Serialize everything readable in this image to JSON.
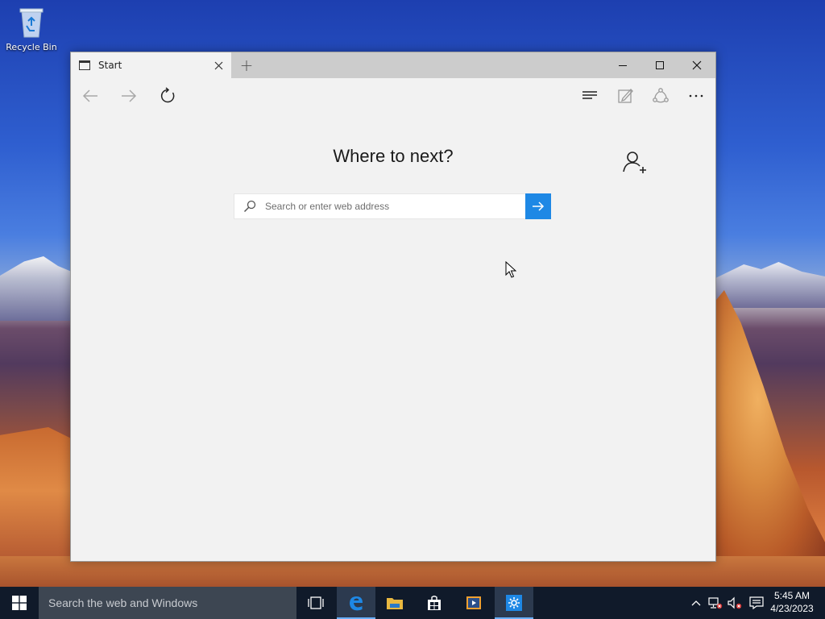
{
  "desktop": {
    "icons": [
      {
        "label": "Recycle Bin",
        "icon": "recycle-bin-icon"
      }
    ]
  },
  "browser": {
    "tabs": [
      {
        "title": "Start",
        "icon": "tab-page-icon",
        "active": true
      }
    ],
    "new_tab_label": "+",
    "window_controls": {
      "minimize": "minimize-icon",
      "maximize": "maximize-icon",
      "close": "close-icon"
    },
    "toolbar": {
      "left": [
        "back-arrow-icon",
        "forward-arrow-icon",
        "refresh-icon"
      ],
      "right": [
        "hub-icon",
        "web-note-icon",
        "share-icon",
        "more-icon"
      ]
    },
    "start_page": {
      "heading": "Where to next?",
      "search": {
        "placeholder": "Search or enter web address",
        "value": ""
      },
      "go_icon": "arrow-right-icon",
      "add_profile_icon": "person-add-icon"
    },
    "accent_color": "#1e88e5"
  },
  "taskbar": {
    "search_text": "Search the web and Windows",
    "apps": [
      {
        "name": "task-view",
        "icon": "task-view-icon"
      },
      {
        "name": "edge",
        "icon": "edge-icon",
        "active": true
      },
      {
        "name": "file-explorer",
        "icon": "folder-icon"
      },
      {
        "name": "store",
        "icon": "store-icon"
      },
      {
        "name": "media",
        "icon": "media-icon"
      },
      {
        "name": "settings",
        "icon": "gear-icon",
        "running": true
      }
    ],
    "tray": [
      "chevron-up-icon",
      "network-icon",
      "volume-muted-icon",
      "action-center-icon"
    ],
    "time": "5:45 AM",
    "date": "4/23/2023"
  }
}
